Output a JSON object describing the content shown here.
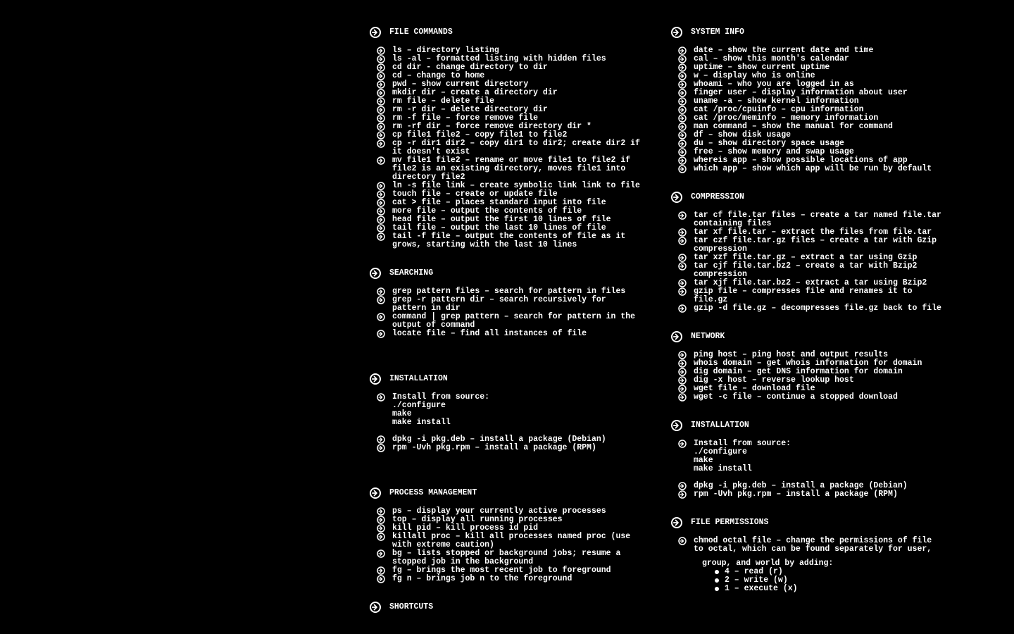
{
  "columns": [
    {
      "name": "left",
      "sections": [
        {
          "name": "file-commands",
          "title": "FILE COMMANDS",
          "items": [
            "ls – directory listing",
            "ls -al – formatted listing with hidden files",
            "cd dir - change directory to dir",
            "cd – change to home",
            "pwd – show current directory",
            "mkdir dir – create a directory dir",
            "rm file – delete file",
            "rm -r dir – delete directory dir",
            "rm -f file – force remove file",
            "rm -rf dir – force remove directory dir *",
            "cp file1 file2 – copy file1 to file2",
            "cp -r dir1 dir2 – copy dir1 to dir2; create dir2 if it doesn't exist",
            "mv file1 file2 – rename or move file1 to file2 if file2 is an existing directory, moves file1 into directory file2",
            "ln -s file link – create symbolic link link to file",
            "touch file – create or update file",
            "cat > file – places standard input into file",
            "more file – output the contents of file",
            "head file – output the first 10 lines of file",
            "tail file – output the last 10 lines of file",
            "tail -f file – output the contents of file as it grows, starting with the last 10 lines"
          ]
        },
        {
          "name": "searching",
          "title": "SEARCHING",
          "items": [
            "grep pattern files – search for pattern in files",
            "grep -r pattern dir – search recursively for pattern in dir",
            "command | grep pattern – search for pattern in the output of command",
            "locate file – find all instances of file"
          ],
          "extraGapAfter": true
        },
        {
          "name": "installation-left",
          "title": "INSTALLATION",
          "items": [
            "Install from source:\n./configure\nmake\nmake install",
            "dpkg -i pkg.deb – install a package (Debian)",
            "rpm -Uvh pkg.rpm – install a package (RPM)"
          ],
          "gapAfterIndex": 0,
          "extraGapAfter": true
        },
        {
          "name": "process-management",
          "title": "PROCESS MANAGEMENT",
          "items": [
            "ps – display your currently active processes",
            "top – display all running processes",
            "kill pid – kill process id pid",
            "killall proc – kill all processes named proc (use with extreme caution)",
            "bg – lists stopped or background jobs; resume a stopped job in the background",
            "fg – brings the most recent job to foreground",
            "fg n – brings job n to the foreground"
          ]
        },
        {
          "name": "shortcuts",
          "title": "SHORTCUTS",
          "items": []
        }
      ]
    },
    {
      "name": "right",
      "sections": [
        {
          "name": "system-info",
          "title": "SYSTEM INFO",
          "items": [
            "date – show the current date and time",
            "cal – show this month's calendar",
            "uptime – show current uptime",
            "w – display who is online",
            "whoami – who you are logged in as",
            "finger user – display information about user",
            "uname -a – show kernel information",
            "cat /proc/cpuinfo – cpu information",
            "cat /proc/meminfo – memory information",
            "man command – show the manual for command",
            "df – show disk usage",
            "du – show directory space usage",
            "free – show memory and swap usage",
            "whereis app – show possible locations of app",
            "which app – show which app will be run by default"
          ]
        },
        {
          "name": "compression",
          "title": "COMPRESSION",
          "items": [
            "tar cf file.tar files – create a tar named file.tar containing files",
            "tar xf file.tar – extract the files from file.tar",
            "tar czf file.tar.gz files – create a tar with Gzip compression",
            "tar xzf file.tar.gz – extract a tar using Gzip",
            "tar cjf file.tar.bz2 – create a tar with Bzip2 compression",
            "tar xjf file.tar.bz2 – extract a tar using Bzip2",
            "gzip file – compresses file and renames it to file.gz",
            "gzip -d file.gz – decompresses file.gz back to file"
          ]
        },
        {
          "name": "network",
          "title": "NETWORK",
          "items": [
            "ping host – ping host and output results",
            "whois domain – get whois information for domain",
            "dig domain – get DNS information for domain",
            "dig -x host – reverse lookup host",
            "wget file – download file",
            "wget -c file – continue a stopped download"
          ]
        },
        {
          "name": "installation-right",
          "title": "INSTALLATION",
          "items": [
            "Install from source:\n./configure\nmake\nmake install",
            "dpkg -i pkg.deb – install a package (Debian)",
            "rpm -Uvh pkg.rpm – install a package (RPM)"
          ],
          "gapAfterIndex": 0
        },
        {
          "name": "file-permissions",
          "title": "FILE PERMISSIONS",
          "items": [
            "chmod octal file – change the permissions of file to octal, which can be found separately for user,"
          ],
          "sub": {
            "intro": "group, and world by adding:",
            "lines": [
              "4 – read (r)",
              "2 – write (w)",
              "1 – execute (x)"
            ]
          }
        }
      ]
    }
  ]
}
